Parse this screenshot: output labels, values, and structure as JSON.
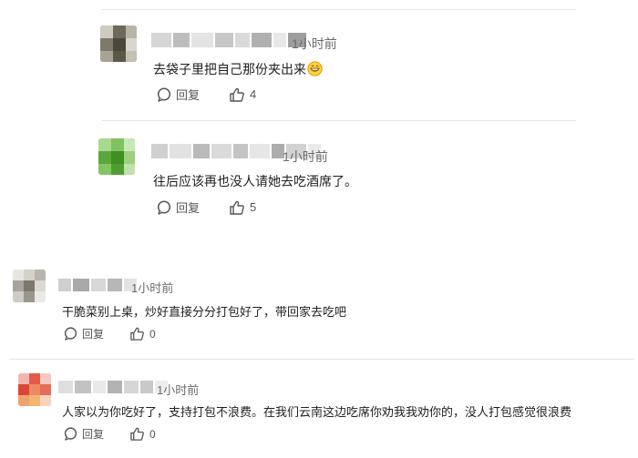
{
  "comments": [
    {
      "time": "1小时前",
      "text": "去袋子里把自己那份夹出来",
      "reply_label": "回复",
      "likes": "4"
    },
    {
      "time": "1小时前",
      "text": "往后应该再也没人请她去吃酒席了。",
      "reply_label": "回复",
      "likes": "5"
    },
    {
      "time": "1小时前",
      "text": "干脆菜别上桌，炒好直接分分打包好了，带回家去吃吧",
      "reply_label": "回复",
      "likes": "0"
    },
    {
      "time": "1小时前",
      "text": "人家以为你吃好了，支持打包不浪费。在我们云南这边吃席你劝我我劝你的，没人打包感觉很浪费",
      "reply_label": "回复",
      "likes": "0"
    }
  ],
  "icons": {
    "reply": "reply-bubble-icon",
    "like": "thumbs-up-icon",
    "emoji": "grinning-face-icon"
  },
  "colors": {
    "time": "#6b6b6b",
    "text": "#1f1f1f",
    "divider": "#e6e6e6"
  }
}
